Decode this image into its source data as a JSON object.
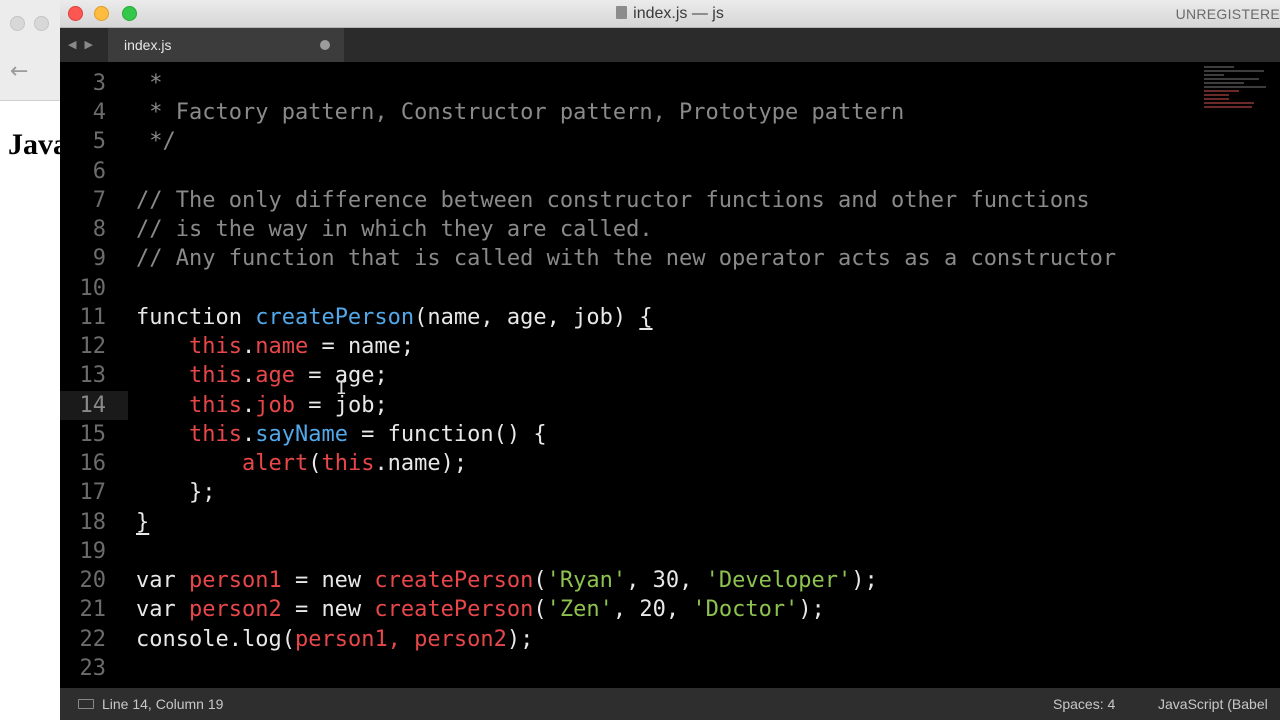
{
  "background_window": {
    "heading_fragment": "Java"
  },
  "window": {
    "title": "index.js — js",
    "unregistered": "UNREGISTERE"
  },
  "tabs": [
    {
      "label": "index.js",
      "dirty": true
    }
  ],
  "editor": {
    "lines": [
      {
        "number": "3"
      },
      {
        "number": "4"
      },
      {
        "number": "5"
      },
      {
        "number": "6"
      },
      {
        "number": "7"
      },
      {
        "number": "8"
      },
      {
        "number": "9"
      },
      {
        "number": "10"
      },
      {
        "number": "11"
      },
      {
        "number": "12"
      },
      {
        "number": "13"
      },
      {
        "number": "14"
      },
      {
        "number": "15"
      },
      {
        "number": "16"
      },
      {
        "number": "17"
      },
      {
        "number": "18"
      },
      {
        "number": "19"
      },
      {
        "number": "20"
      },
      {
        "number": "21"
      },
      {
        "number": "22"
      },
      {
        "number": "23"
      }
    ],
    "tokens": {
      "l3": " *",
      "l4": " * Factory pattern, Constructor pattern, Prototype pattern",
      "l5": " */",
      "l7": "// The only difference between constructor functions and other functions",
      "l8": "// is the way in which they are called.",
      "l9": "// Any function that is called with the new operator acts as a constructor",
      "l11_kw": "function ",
      "l11_fn": "createPerson",
      "l11_rest": "(name, age, job) ",
      "l11_brace": "{",
      "indent1": "    ",
      "indent2": "        ",
      "this": "this",
      "dot": ".",
      "l12_prop": "name",
      "l12_rest": " = name;",
      "l13_prop": "age",
      "l13_rest": " = age;",
      "l14_prop": "job",
      "l14_rest": " = job;",
      "l15_prop": "sayName",
      "l15_rest": " = function() {",
      "l16_fn": "alert",
      "l16_open": "(",
      "l16_rest": ".name);",
      "l17": "    };",
      "l18": "}",
      "var": "var ",
      "l20_var": "person1",
      "l21_var": "person2",
      "eq_new": " = new ",
      "create": "createPerson",
      "l20_open": "(",
      "l20_s1": "'Ryan'",
      "l20_mid": ", 30, ",
      "l20_s2": "'Developer'",
      "l20_end": ");",
      "l21_s1": "'Zen'",
      "l21_mid": ", 20, ",
      "l21_s2": "'Doctor'",
      "l22_a": "console.",
      "l22_fn": "log",
      "l22_open": "(",
      "l22_args": "person1, person2",
      "l22_end": ");"
    }
  },
  "status": {
    "position": "Line 14, Column 19",
    "spaces": "Spaces: 4",
    "syntax": "JavaScript (Babel"
  },
  "colors": {
    "comment": "#8a8a8a",
    "function_name": "#52a8e8",
    "keyword_this": "#e8474a",
    "string": "#8ec24f"
  }
}
